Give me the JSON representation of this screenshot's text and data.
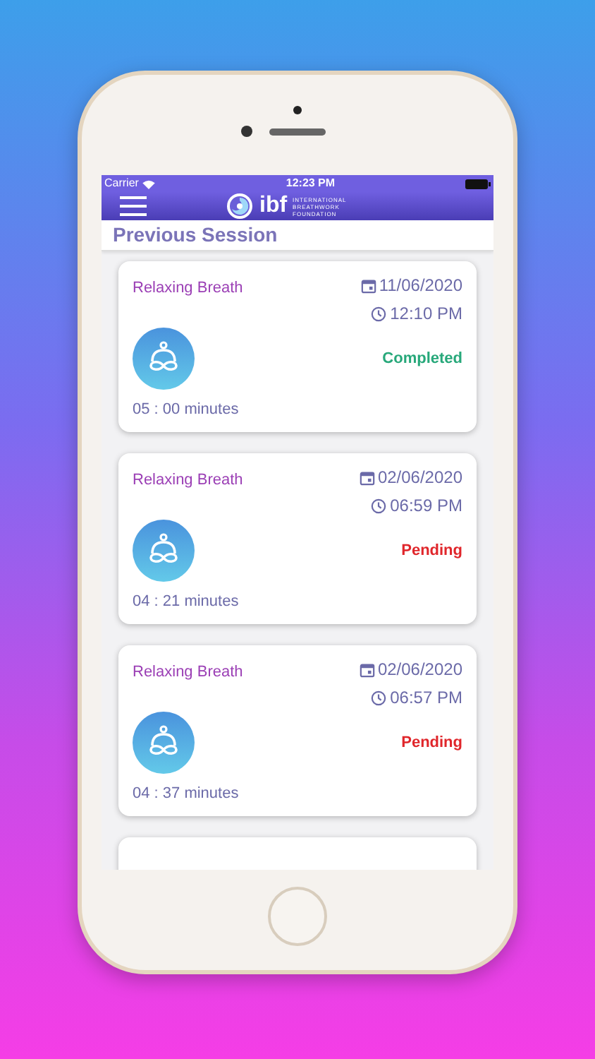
{
  "status_bar": {
    "carrier": "Carrier",
    "time": "12:23 PM"
  },
  "header": {
    "logo_text": "ibf",
    "logo_subtitle": [
      "INTERNATIONAL",
      "BREATHWORK",
      "FOUNDATION"
    ]
  },
  "page_title": "Previous Session",
  "sessions": [
    {
      "title": "Relaxing Breath",
      "date": "11/06/2020",
      "time": "12:10 PM",
      "status": "Completed",
      "kind": "completed",
      "duration": "05 : 00 minutes"
    },
    {
      "title": "Relaxing Breath",
      "date": "02/06/2020",
      "time": "06:59 PM",
      "status": "Pending",
      "kind": "pending",
      "duration": "04 : 21 minutes"
    },
    {
      "title": "Relaxing Breath",
      "date": "02/06/2020",
      "time": "06:57 PM",
      "status": "Pending",
      "kind": "pending",
      "duration": "04 : 37 minutes"
    }
  ]
}
